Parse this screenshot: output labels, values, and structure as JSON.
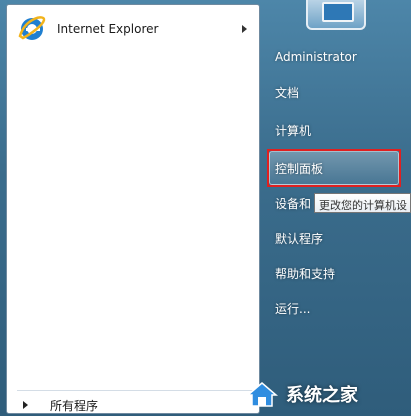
{
  "left": {
    "pinned": [
      {
        "label": "Internet Explorer",
        "icon": "internet-explorer-icon"
      }
    ],
    "all_programs_label": "所有程序"
  },
  "right": {
    "items": [
      {
        "label": "Administrator"
      },
      {
        "label": "文档"
      },
      {
        "label": "计算机"
      },
      {
        "label": "控制面板"
      },
      {
        "label": "设备和"
      },
      {
        "label": "默认程序"
      },
      {
        "label": "帮助和支持"
      },
      {
        "label": "运行..."
      }
    ]
  },
  "tooltip": {
    "text": "更改您的计算机设"
  },
  "watermark": {
    "text": "系统之家"
  },
  "colors": {
    "frame": "#3b6d8d",
    "highlight_border": "#e02020",
    "ie_blue": "#1f7fd0",
    "ie_ring": "#f2b31b"
  }
}
